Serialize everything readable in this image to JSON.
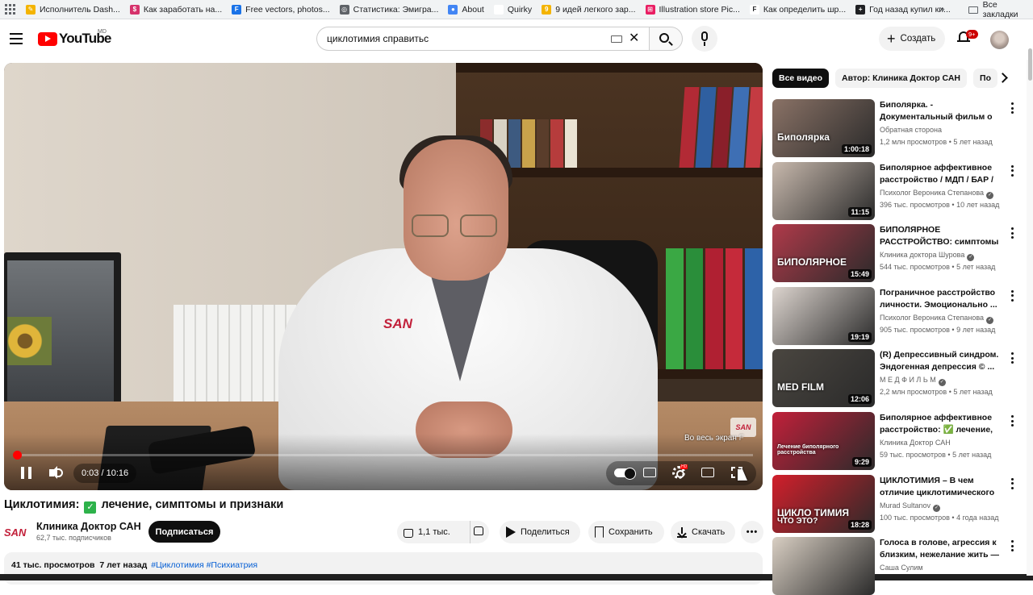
{
  "bookmarks": {
    "items": [
      {
        "label": "Исполнитель Dash...",
        "color": "#f4b400",
        "glyph": "✎"
      },
      {
        "label": "Как заработать на...",
        "color": "#d6336c",
        "glyph": "$"
      },
      {
        "label": "Free vectors, photos...",
        "color": "#1a73e8",
        "glyph": "F"
      },
      {
        "label": "Статистика: Эмигра...",
        "color": "#5f6368",
        "glyph": "◎"
      },
      {
        "label": "About",
        "color": "#4285f4",
        "glyph": "●"
      },
      {
        "label": "Quirky",
        "color": "#ffffff",
        "glyph": ""
      },
      {
        "label": "9 идей легкого зар...",
        "color": "#f4b400",
        "glyph": "9"
      },
      {
        "label": "Illustration store Pic...",
        "color": "#e91e63",
        "glyph": "⊞"
      },
      {
        "label": "Как определить шр...",
        "color": "#ffffff",
        "glyph": "F"
      },
      {
        "label": "Год назад купил ки...",
        "color": "#202124",
        "glyph": "+"
      }
    ],
    "more": "»",
    "folder_label": "Все закладки"
  },
  "masthead": {
    "logo_text": "YouTube",
    "country": "MD",
    "search_value": "циклотимия справитьс",
    "create_label": "Создать",
    "notifications_badge": "9+"
  },
  "player": {
    "time": "0:03 / 10:16",
    "progress": 0.005,
    "fullscreen_tooltip": "Во весь экран",
    "fullscreen_key": "F",
    "scene_logo": "SAN",
    "watermark": "SAN",
    "hd_badge": "HD"
  },
  "video": {
    "title_before": "Циклотимия:",
    "check_glyph": "✓",
    "title_after": "лечение, симптомы и признаки",
    "channel_logo": "SAN",
    "channel_name": "Клиника Доктор САН",
    "subscribers": "62,7 тыс. подписчиков",
    "subscribe_label": "Подписаться",
    "likes": "1,1 тыс.",
    "share_label": "Поделиться",
    "save_label": "Сохранить",
    "download_label": "Скачать",
    "more_label": "•••",
    "views": "41 тыс. просмотров",
    "age": "7 лет назад",
    "hashtags": "#Циклотимия #Психиатрия"
  },
  "sidebar": {
    "chips": [
      "Все видео",
      "Автор: Клиника Доктор САН",
      "По"
    ],
    "recommendations": [
      {
        "title": "Биполярка. - Документальный фильм о ...",
        "channel": "Обратная сторона",
        "verified": false,
        "views": "1,2 млн просмотров",
        "age": "5 лет назад",
        "duration": "1:00:18",
        "thumb_text": "Биполярка",
        "thumb_color": "#8a7266"
      },
      {
        "title": "Биполярное аффективное расстройство / МДП / БАР / ...",
        "channel": "Психолог Вероника Степанова",
        "verified": true,
        "views": "396 тыс. просмотров",
        "age": "10 лет назад",
        "duration": "11:15",
        "thumb_text": "",
        "thumb_color": "#c8b9ad"
      },
      {
        "title": "БИПОЛЯРНОЕ РАССТРОЙСТВО: симптомы ...",
        "channel": "Клиника доктора Шурова",
        "verified": true,
        "views": "544 тыс. просмотров",
        "age": "5 лет назад",
        "duration": "15:49",
        "thumb_text": "БИПОЛЯРНОЕ",
        "thumb_color": "#b03a4a"
      },
      {
        "title": "Пограничное расстройство личности. Эмоционально ...",
        "channel": "Психолог Вероника Степанова",
        "verified": true,
        "views": "905 тыс. просмотров",
        "age": "9 лет назад",
        "duration": "19:19",
        "thumb_text": "",
        "thumb_color": "#ddd5cf"
      },
      {
        "title": "(R) Депрессивный синдром. Эндогенная депрессия © ...",
        "channel": "М Е Д Ф И Л Ь М",
        "verified": true,
        "views": "2,2 млн просмотров",
        "age": "5 лет назад",
        "duration": "12:06",
        "thumb_text": "MED FILM",
        "thumb_color": "#4a4640"
      },
      {
        "title": "Биполярное аффективное расстройство: ✅ лечение, ...",
        "channel": "Клиника Доктор САН",
        "verified": false,
        "views": "59 тыс. просмотров",
        "age": "5 лет назад",
        "duration": "9:29",
        "thumb_text": "Лечение биполярного расстройства",
        "thumb_color": "#c2203a"
      },
      {
        "title": "ЦИКЛОТИМИЯ – В чем отличие циклотимического ...",
        "channel": "Murad Sultanov",
        "verified": true,
        "views": "100 тыс. просмотров",
        "age": "4 года назад",
        "duration": "18:28",
        "thumb_text": "ЦИКЛО ТИМИЯ",
        "thumb_sub": "ЧТО ЭТО?",
        "thumb_color": "#d21f2b"
      },
      {
        "title": "Голоса в голове, агрессия к близким, нежелание жить — ...",
        "channel": "Саша Сулим",
        "verified": false,
        "views": "",
        "age": "",
        "duration": "",
        "thumb_text": "",
        "thumb_color": "#d9cfc3"
      }
    ]
  }
}
